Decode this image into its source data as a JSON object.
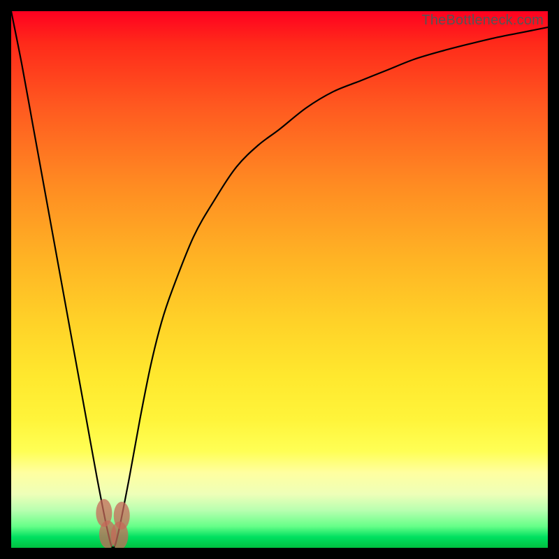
{
  "watermark": "TheBottleneck.com",
  "colors": {
    "frame": "#000000",
    "gradient_top": "#ff0020",
    "gradient_mid": "#ffd228",
    "gradient_bottom": "#00c040",
    "curve_stroke": "#000000",
    "marker_fill": "#c56a5a"
  },
  "chart_data": {
    "type": "line",
    "title": "",
    "xlabel": "",
    "ylabel": "",
    "xlim": [
      0,
      100
    ],
    "ylim": [
      0,
      100
    ],
    "legend": false,
    "grid": false,
    "annotations": [
      "TheBottleneck.com"
    ],
    "series": [
      {
        "name": "bottleneck-curve",
        "x": [
          0,
          2,
          4,
          6,
          8,
          10,
          12,
          14,
          16,
          18,
          19,
          20,
          22,
          24,
          26,
          28,
          30,
          34,
          38,
          42,
          46,
          50,
          55,
          60,
          65,
          70,
          75,
          80,
          85,
          90,
          95,
          100
        ],
        "values": [
          100,
          90,
          79,
          68,
          57,
          46,
          35,
          24,
          13,
          3,
          0,
          3,
          13,
          24,
          34,
          42,
          48,
          58,
          65,
          71,
          75,
          78,
          82,
          85,
          87,
          89,
          91,
          92.5,
          93.8,
          95,
          96,
          97
        ]
      }
    ],
    "markers": [
      {
        "name": "left-blob-1",
        "x": 17.3,
        "y": 6.5,
        "rx": 1.5,
        "ry": 2.6
      },
      {
        "name": "left-blob-2",
        "x": 18.0,
        "y": 2.5,
        "rx": 1.6,
        "ry": 2.6
      },
      {
        "name": "right-blob-1",
        "x": 20.6,
        "y": 6.0,
        "rx": 1.5,
        "ry": 2.6
      },
      {
        "name": "right-blob-2",
        "x": 20.2,
        "y": 2.3,
        "rx": 1.6,
        "ry": 2.6
      }
    ]
  }
}
